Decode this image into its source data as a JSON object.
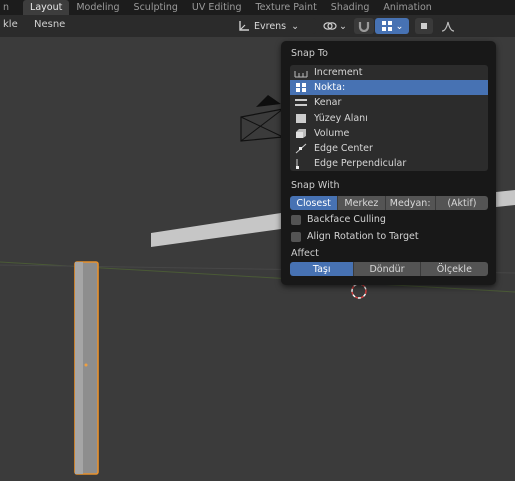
{
  "topbar": {
    "tabs": [
      {
        "label": "n",
        "active": false
      },
      {
        "label": "Layout",
        "active": true
      },
      {
        "label": "Modeling",
        "active": false
      },
      {
        "label": "Sculpting",
        "active": false
      },
      {
        "label": "UV Editing",
        "active": false
      },
      {
        "label": "Texture Paint",
        "active": false
      },
      {
        "label": "Shading",
        "active": false
      },
      {
        "label": "Animation",
        "active": false
      }
    ]
  },
  "viewport_header": {
    "menu_left": "kle",
    "menu_object": "Nesne",
    "orientation": "Evrens",
    "chevron": "⌄"
  },
  "popover": {
    "snap_to_title": "Snap To",
    "snap_to_items": [
      {
        "label": "Increment",
        "icon": "increment-icon",
        "selected": false
      },
      {
        "label": "Nokta:",
        "icon": "vertex-icon",
        "selected": true
      },
      {
        "label": "Kenar",
        "icon": "edge-icon",
        "selected": false
      },
      {
        "label": "Yüzey Alanı",
        "icon": "face-icon",
        "selected": false
      },
      {
        "label": "Volume",
        "icon": "volume-icon",
        "selected": false
      },
      {
        "label": "Edge Center",
        "icon": "edge-center-icon",
        "selected": false
      },
      {
        "label": "Edge Perpendicular",
        "icon": "edge-perpendicular-icon",
        "selected": false
      }
    ],
    "snap_with_title": "Snap With",
    "snap_with_options": [
      {
        "label": "Closest",
        "selected": true
      },
      {
        "label": "Merkez",
        "selected": false
      },
      {
        "label": "Medyan:",
        "selected": false
      },
      {
        "label": "(Aktif)",
        "selected": false
      }
    ],
    "backface_culling": "Backface Culling",
    "align_rotation": "Align Rotation to Target",
    "affect_title": "Affect",
    "affect_options": [
      {
        "label": "Taşı",
        "selected": true
      },
      {
        "label": "Döndür",
        "selected": false
      },
      {
        "label": "Ölçekle",
        "selected": false
      }
    ]
  },
  "colors": {
    "accent": "#4772b3",
    "selection_outline": "#e8912d",
    "background": "#3b3b3b"
  }
}
